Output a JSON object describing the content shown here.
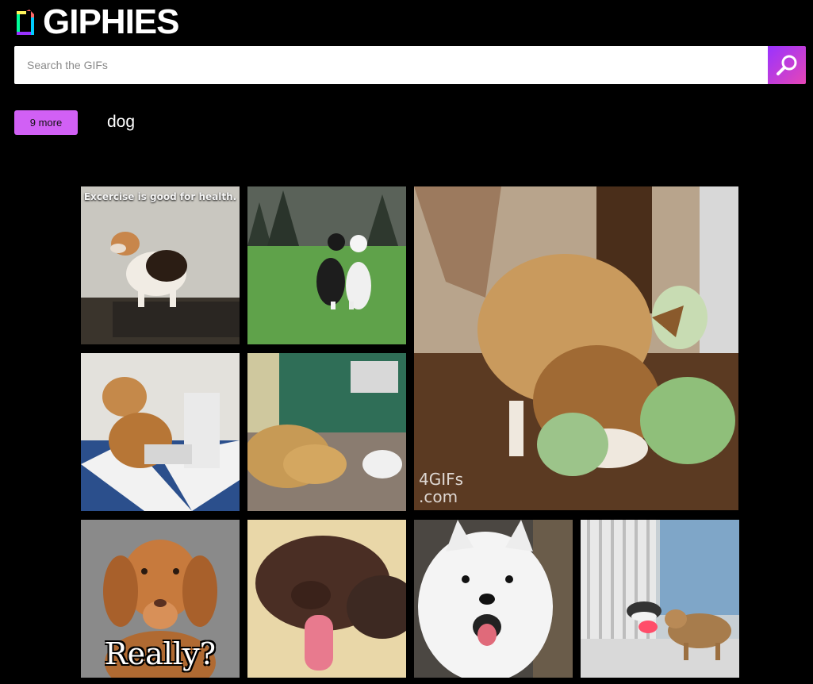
{
  "app": {
    "title": "GIPHIES"
  },
  "search": {
    "placeholder": "Search the GIFs",
    "value": ""
  },
  "tags": {
    "more_label": "9 more",
    "query": "dog"
  },
  "gifs": [
    {
      "subject": "beagle on treadmill",
      "caption": "Excercise is good for health."
    },
    {
      "subject": "two dogs on lawn"
    },
    {
      "subject": "corgi pushing cabbages",
      "watermark": "4GIFs\n.com"
    },
    {
      "subject": "shiba inu typing on laptop"
    },
    {
      "subject": "golden retriever lying on floor"
    },
    {
      "subject": "vizsla puppy",
      "caption": "Really?"
    },
    {
      "subject": "brown dog sleeping with tongue out"
    },
    {
      "subject": "smiling samoyed"
    },
    {
      "subject": "cat and dog in hallway"
    }
  ],
  "colors": {
    "background": "#000000",
    "accent": "#d160f5",
    "search_gradient_start": "#9933ff",
    "search_gradient_end": "#e646b6"
  }
}
